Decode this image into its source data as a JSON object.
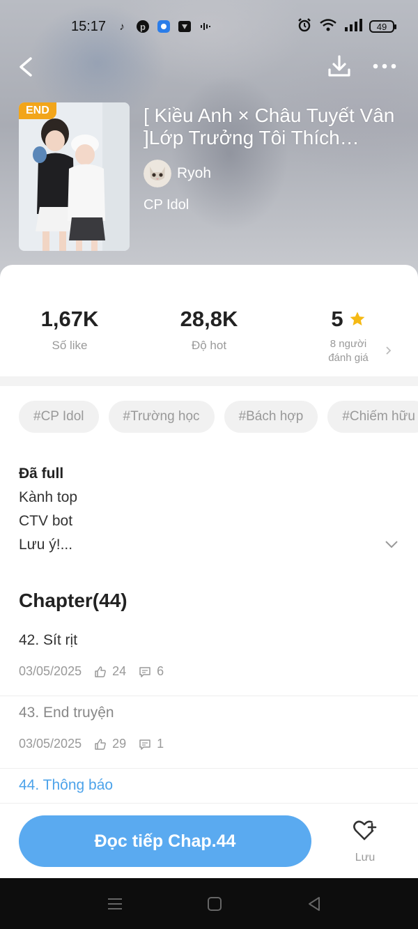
{
  "status_bar": {
    "time": "15:17",
    "battery": "49",
    "app_icons": [
      "tiktok-icon",
      "pinterest-icon",
      "app-icon",
      "video-app-icon",
      "audio-icon"
    ]
  },
  "header": {
    "back_icon": "chevron-left-icon",
    "download_icon": "download-icon",
    "more_icon": "more-dots-icon"
  },
  "story": {
    "badge": "END",
    "title": "[ Kiều Anh × Châu Tuyết Vân ]Lớp Trưởng Tôi Thích…",
    "author": "Ryoh",
    "genre": "CP Idol"
  },
  "stats": {
    "likes_value": "1,67K",
    "likes_label": "Số like",
    "hot_value": "28,8K",
    "hot_label": "Độ hot",
    "rating_value": "5",
    "rating_line1": "8 người",
    "rating_line2": "đánh giá"
  },
  "tags": [
    "#CP Idol",
    "#Trường học",
    "#Bách hợp",
    "#Chiếm hữu"
  ],
  "description": {
    "line1": "Đã full",
    "line2": "Kành top",
    "line3": "CTV bot",
    "line4": "Lưu ý!..."
  },
  "chapters": {
    "heading": "Chapter(44)",
    "items": [
      {
        "title": "42. Sít rịt",
        "date": "03/05/2025",
        "likes": "24",
        "comments": "6"
      },
      {
        "title": "43. End truyện",
        "date": "03/05/2025",
        "likes": "29",
        "comments": "1"
      },
      {
        "title": "44. Thông báo"
      }
    ]
  },
  "bottom": {
    "read_button": "Đọc tiếp Chap.44",
    "save_label": "Lưu"
  },
  "colors": {
    "accent": "#5aaaf0",
    "badge": "#f2a51a",
    "star": "#f5b914"
  }
}
